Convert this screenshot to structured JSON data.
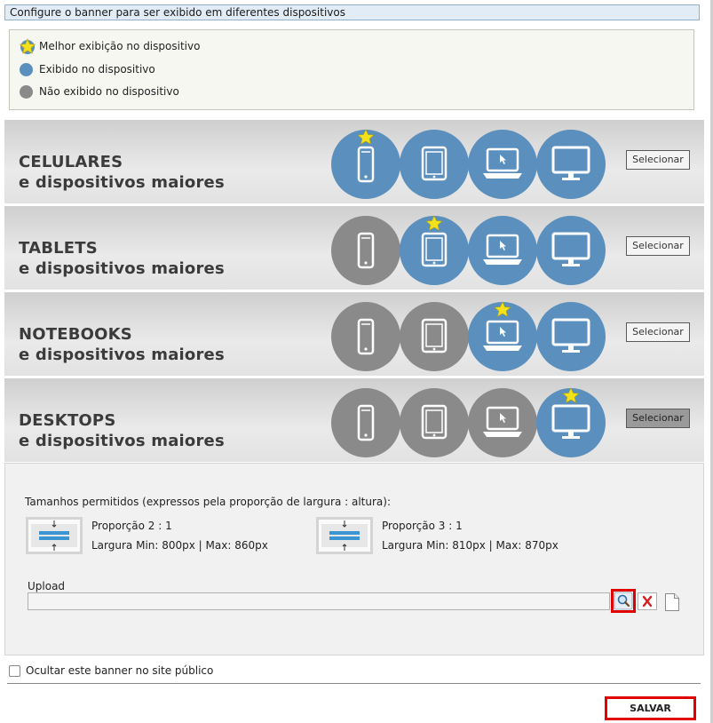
{
  "topbar": {
    "title": "Configure o banner para ser exibido em diferentes dispositivos"
  },
  "legend": {
    "best": "Melhor exibição no dispositivo",
    "shown": "Exibido no dispositivo",
    "not_shown": "Não exibido no dispositivo"
  },
  "devices": [
    {
      "title": "CELULARES",
      "subtitle": "e dispositivos maiores",
      "button": "Selecionar",
      "active": false,
      "icons": [
        "blue-star",
        "blue",
        "blue",
        "blue"
      ]
    },
    {
      "title": "TABLETS",
      "subtitle": "e dispositivos maiores",
      "button": "Selecionar",
      "active": false,
      "icons": [
        "gray",
        "blue-star",
        "blue",
        "blue"
      ]
    },
    {
      "title": "NOTEBOOKS",
      "subtitle": "e dispositivos maiores",
      "button": "Selecionar",
      "active": false,
      "icons": [
        "gray",
        "gray",
        "blue-star",
        "blue"
      ]
    },
    {
      "title": "DESKTOPS",
      "subtitle": "e dispositivos maiores",
      "button": "Selecionar",
      "active": true,
      "icons": [
        "gray",
        "gray",
        "gray",
        "blue-star"
      ]
    }
  ],
  "sizes": {
    "heading": "Tamanhos permitidos (expressos pela proporção de largura : altura):",
    "items": [
      {
        "ratio": "Proporção 2 : 1",
        "limits": "Largura Min: 800px | Max: 860px"
      },
      {
        "ratio": "Proporção 3 : 1",
        "limits": "Largura Min: 810px | Max: 870px"
      }
    ]
  },
  "upload": {
    "label": "Upload",
    "value": ""
  },
  "hide_option": {
    "label": "Ocultar este banner no site público",
    "checked": false
  },
  "save": {
    "label": "SALVAR"
  },
  "colors": {
    "blue": "#5a8fbe",
    "gray": "#8a8a8a",
    "star": "#f2e11b",
    "highlight": "#e00000"
  }
}
